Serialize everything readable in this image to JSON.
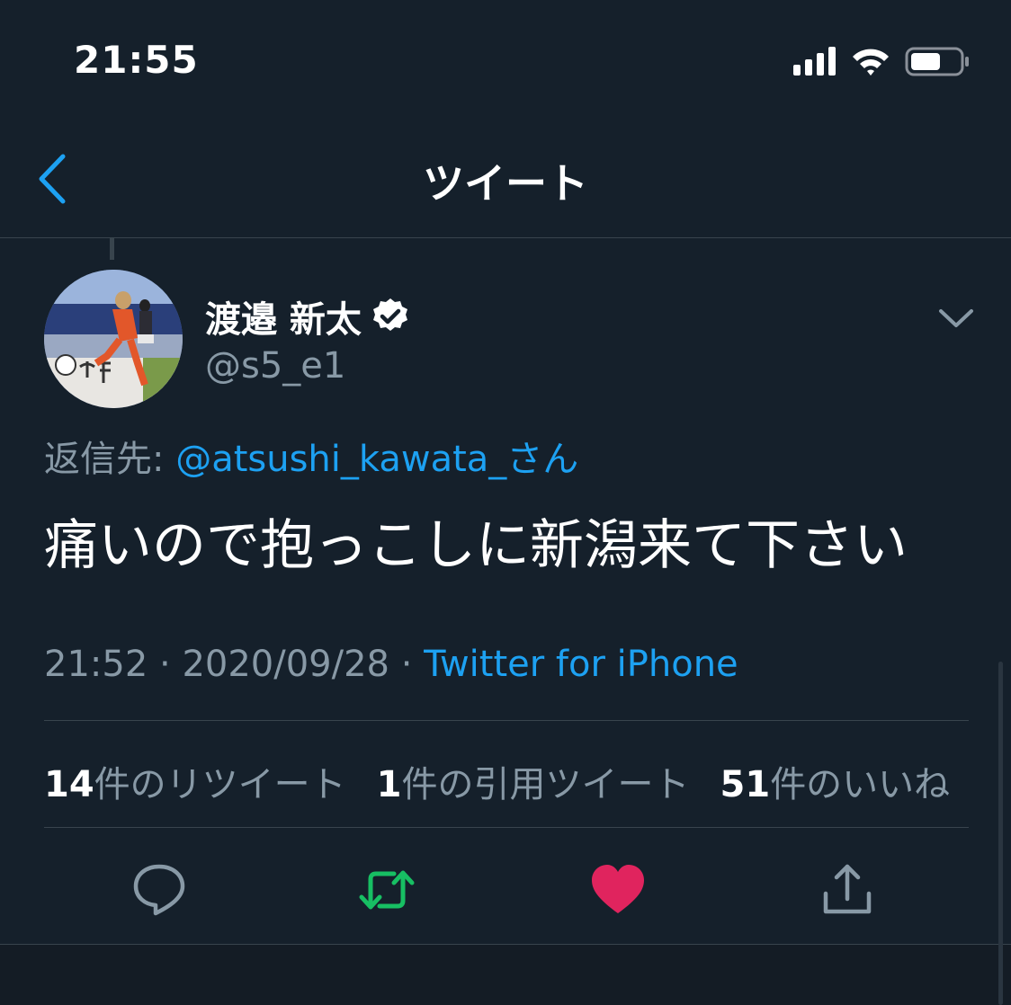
{
  "status_bar": {
    "time": "21:55"
  },
  "nav": {
    "title": "ツイート",
    "back_icon": "chevron-left-icon"
  },
  "author": {
    "name": "渡邉 新太",
    "handle": "@s5_e1",
    "verified": true
  },
  "reply": {
    "label": "返信先: ",
    "target": "@atsushi_kawata_さん"
  },
  "tweet": {
    "text": "痛いので抱っこしに新潟来て下さい",
    "time": "21:52",
    "separator": " · ",
    "date": "2020/09/28",
    "source": "Twitter for iPhone"
  },
  "stats": [
    {
      "count": "14",
      "label": "件のリツイート"
    },
    {
      "count": "1",
      "label": "件の引用ツイート"
    },
    {
      "count": "51",
      "label": "件のいいね"
    }
  ],
  "actions": {
    "reply_icon": "reply-icon",
    "retweet_icon": "retweet-icon",
    "like_icon": "heart-icon",
    "share_icon": "share-icon"
  },
  "colors": {
    "background": "#15202b",
    "accent": "#1da1f2",
    "retweet": "#17bf63",
    "like": "#e0245e",
    "secondary_text": "#8899a6"
  }
}
